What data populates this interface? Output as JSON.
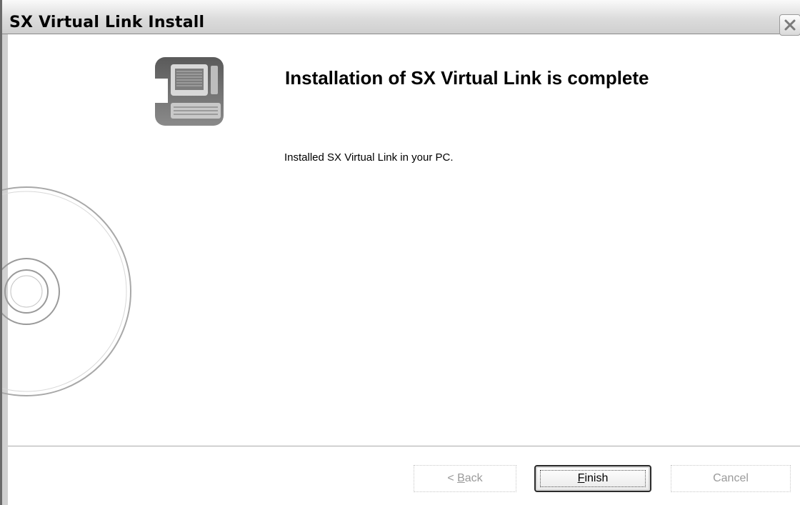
{
  "window": {
    "title": "SX Virtual Link Install"
  },
  "icons": {
    "close": "close-icon",
    "installer": "computer-icon",
    "cd": "cd-disc-icon"
  },
  "main": {
    "heading": "Installation of SX Virtual Link is complete",
    "message": "Installed SX Virtual Link in your PC."
  },
  "buttons": {
    "back_prefix": "< ",
    "back_accel": "B",
    "back_rest": "ack",
    "finish_accel": "F",
    "finish_rest": "inish",
    "cancel": "Cancel"
  }
}
